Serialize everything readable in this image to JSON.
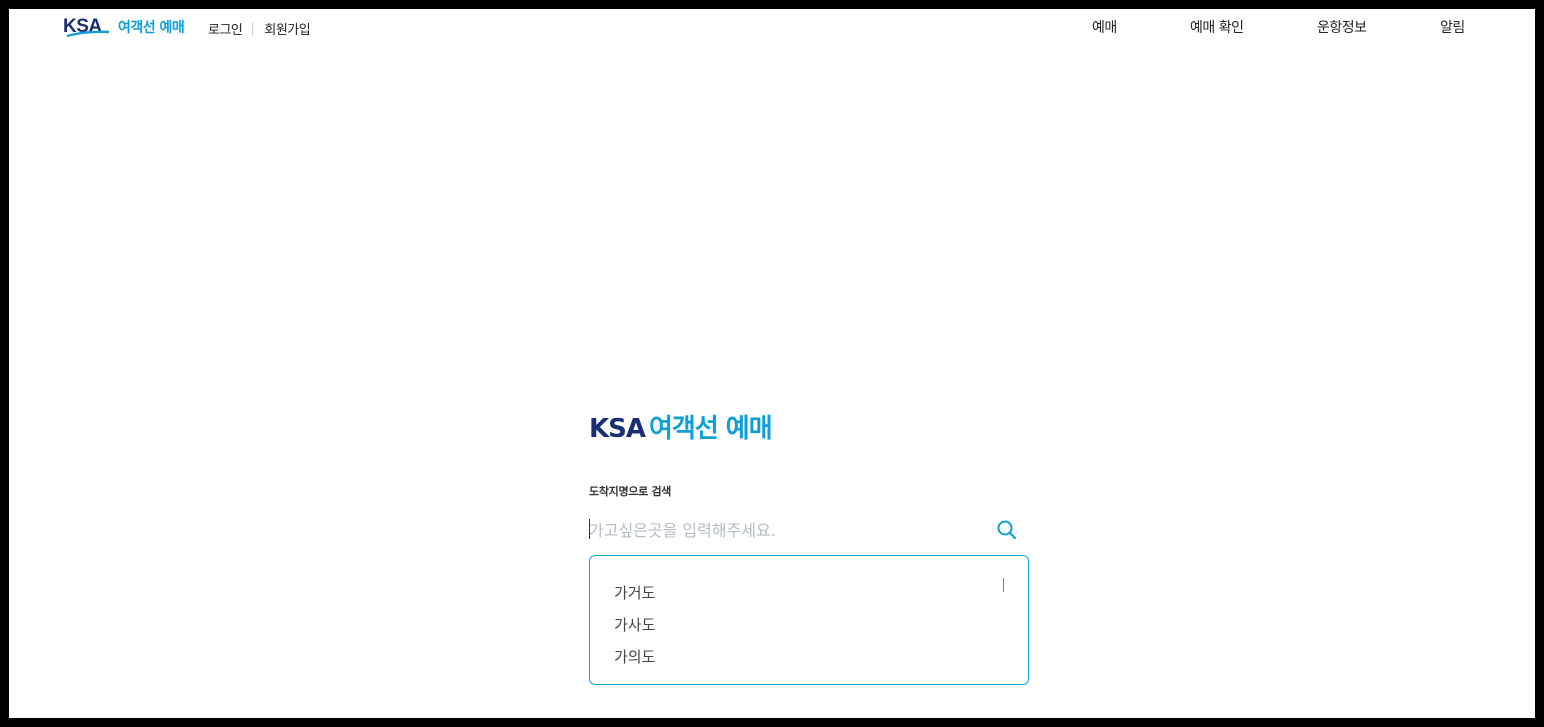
{
  "header": {
    "logo_mark": "KSA",
    "logo_text": "여객선 예매",
    "auth": {
      "login": "로그인",
      "signup": "회원가입"
    },
    "nav": [
      "예매",
      "예매 확인",
      "운항정보",
      "알림"
    ]
  },
  "search": {
    "title_brand": "KSA",
    "title_service": "여객선 예매",
    "label": "도착지명으로 검색",
    "placeholder": "가고싶은곳을 입력해주세요.",
    "value": "",
    "suggestions": [
      "가거도",
      "가사도",
      "가의도"
    ]
  },
  "colors": {
    "brand_navy": "#1a2f72",
    "accent": "#0e9fd8"
  },
  "icons": {
    "search": "search-icon"
  }
}
